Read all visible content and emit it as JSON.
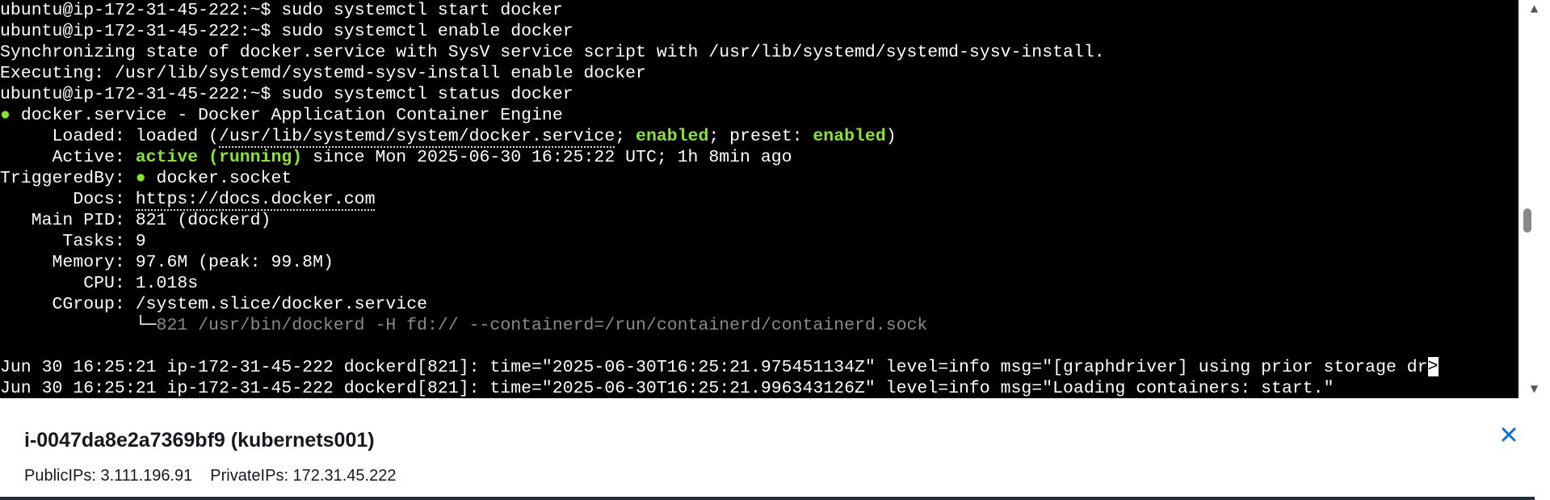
{
  "terminal": {
    "prompt": "ubuntu@ip-172-31-45-222:~$",
    "cmd1": "sudo systemctl start docker",
    "cmd2": "sudo systemctl enable docker",
    "sync_msg": "Synchronizing state of docker.service with SysV service script with /usr/lib/systemd/systemd-sysv-install.",
    "exec_msg": "Executing: /usr/lib/systemd/systemd-sysv-install enable docker",
    "cmd3": "sudo systemctl status docker",
    "status": {
      "bullet": "●",
      "service_line": "docker.service - Docker Application Container Engine",
      "loaded_label": "     Loaded: ",
      "loaded_prefix": "loaded (",
      "loaded_path": "/usr/lib/systemd/system/docker.service",
      "loaded_sep1": "; ",
      "enabled1": "enabled",
      "loaded_sep2": "; preset: ",
      "enabled2": "enabled",
      "loaded_close": ")",
      "active_label": "     Active: ",
      "active_state": "active (running)",
      "active_since": " since Mon 2025-06-30 16:25:22 UTC; 1h 8min ago",
      "triggered_label": "TriggeredBy: ",
      "triggered_value": "docker.socket",
      "docs_label": "       Docs: ",
      "docs_url": "https://docs.docker.com",
      "pid_label": "   Main PID: ",
      "pid_value": "821 (dockerd)",
      "tasks_label": "      Tasks: ",
      "tasks_value": "9",
      "memory_label": "     Memory: ",
      "memory_value": "97.6M (peak: 99.8M)",
      "cpu_label": "        CPU: ",
      "cpu_value": "1.018s",
      "cgroup_label": "     CGroup: ",
      "cgroup_value": "/system.slice/docker.service",
      "cgroup_tree": "             └─",
      "cgroup_process": "821 /usr/bin/dockerd -H fd:// --containerd=/run/containerd/containerd.sock"
    },
    "log1": "Jun 30 16:25:21 ip-172-31-45-222 dockerd[821]: time=\"2025-06-30T16:25:21.975451134Z\" level=info msg=\"[graphdriver] using prior storage dr",
    "log1_more": ">",
    "log2": "Jun 30 16:25:21 ip-172-31-45-222 dockerd[821]: time=\"2025-06-30T16:25:21.996343126Z\" level=info msg=\"Loading containers: start.\""
  },
  "scrollbar": {
    "up_icon": "▲",
    "down_icon": "▼"
  },
  "instance_panel": {
    "title": "i-0047da8e2a7369bf9 (kubernets001)",
    "public_ips": "PublicIPs: 3.111.196.91",
    "private_ips": "PrivateIPs: 172.31.45.222",
    "close_icon": "close-x"
  },
  "colors": {
    "terminal_bg": "#000000",
    "terminal_fg": "#ffffff",
    "status_green": "#8ae234",
    "close_blue": "#0972d3"
  }
}
